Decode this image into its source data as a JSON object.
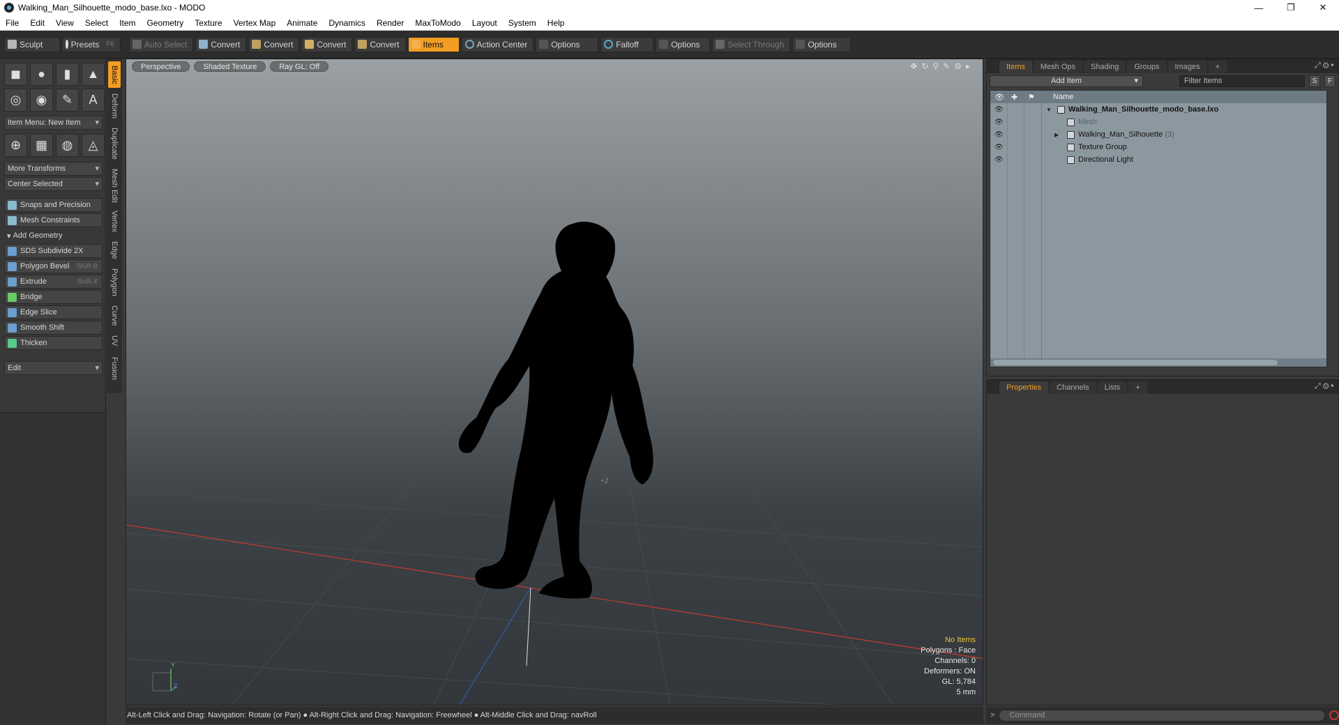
{
  "window": {
    "title": "Walking_Man_Silhouette_modo_base.lxo - MODO",
    "minimize": "—",
    "restore": "❐",
    "close": "✕"
  },
  "menu": [
    "File",
    "Edit",
    "View",
    "Select",
    "Item",
    "Geometry",
    "Texture",
    "Vertex Map",
    "Animate",
    "Dynamics",
    "Render",
    "MaxToModo",
    "Layout",
    "System",
    "Help"
  ],
  "toolbar": {
    "sculpt": "Sculpt",
    "presets": "Presets",
    "presets_key": "F6",
    "auto_select": "Auto Select",
    "convert1": "Convert",
    "convert2": "Convert",
    "convert3": "Convert",
    "convert4": "Convert",
    "items": "Items",
    "action_center": "Action Center",
    "options1": "Options",
    "falloff": "Falloff",
    "options2": "Options",
    "select_through": "Select Through",
    "options3": "Options"
  },
  "left": {
    "item_menu": "Item Menu: New Item",
    "more_transforms": "More Transforms",
    "center_selected": "Center Selected",
    "snaps": "Snaps and Precision",
    "mesh_constraints": "Mesh Constraints",
    "add_geometry": "Add Geometry",
    "tools": [
      {
        "label": "SDS Subdivide 2X",
        "key": ""
      },
      {
        "label": "Polygon Bevel",
        "key": "Shift-B"
      },
      {
        "label": "Extrude",
        "key": "Shift-X"
      },
      {
        "label": "Bridge",
        "key": ""
      },
      {
        "label": "Edge Slice",
        "key": ""
      },
      {
        "label": "Smooth Shift",
        "key": ""
      },
      {
        "label": "Thicken",
        "key": ""
      }
    ],
    "edit": "Edit"
  },
  "vtabs": [
    "Basic",
    "Deform",
    "Duplicate",
    "Mesh Edit",
    "Vertex",
    "Edge",
    "Polygon",
    "Curve",
    "UV",
    "Fusion"
  ],
  "viewport": {
    "perspective": "Perspective",
    "shaded_texture": "Shaded Texture",
    "ray_gl": "Ray GL: Off",
    "info": {
      "no_items": "No Items",
      "polygons": "Polygons : Face",
      "channels": "Channels: 0",
      "deformers": "Deformers: ON",
      "gl": "GL: 5,784",
      "scale": "5 mm"
    },
    "zlabel": "+Z",
    "axis_y": "Y",
    "axis_z": "Z"
  },
  "status": "Alt-Left Click and Drag: Navigation: Rotate (or Pan) ● Alt-Right Click and Drag: Navigation: Freewheel ● Alt-Middle Click and Drag: navRoll",
  "items_panel": {
    "tabs": [
      "Items",
      "Mesh Ops",
      "Shading",
      "Groups",
      "Images"
    ],
    "add_item": "Add Item",
    "filter_placeholder": "Filter Items",
    "s_btn": "S",
    "f_btn": "F",
    "name_col": "Name",
    "rows": [
      {
        "label": "Walking_Man_Silhouette_modo_base.lxo",
        "count": ""
      },
      {
        "label": "Mesh",
        "count": ""
      },
      {
        "label": "Walking_Man_Silhouette",
        "count": "(3)"
      },
      {
        "label": "Texture Group",
        "count": ""
      },
      {
        "label": "Directional Light",
        "count": ""
      }
    ]
  },
  "props_panel": {
    "tabs": [
      "Properties",
      "Channels",
      "Lists"
    ]
  },
  "command": {
    "prompt": ">",
    "placeholder": "Command"
  }
}
